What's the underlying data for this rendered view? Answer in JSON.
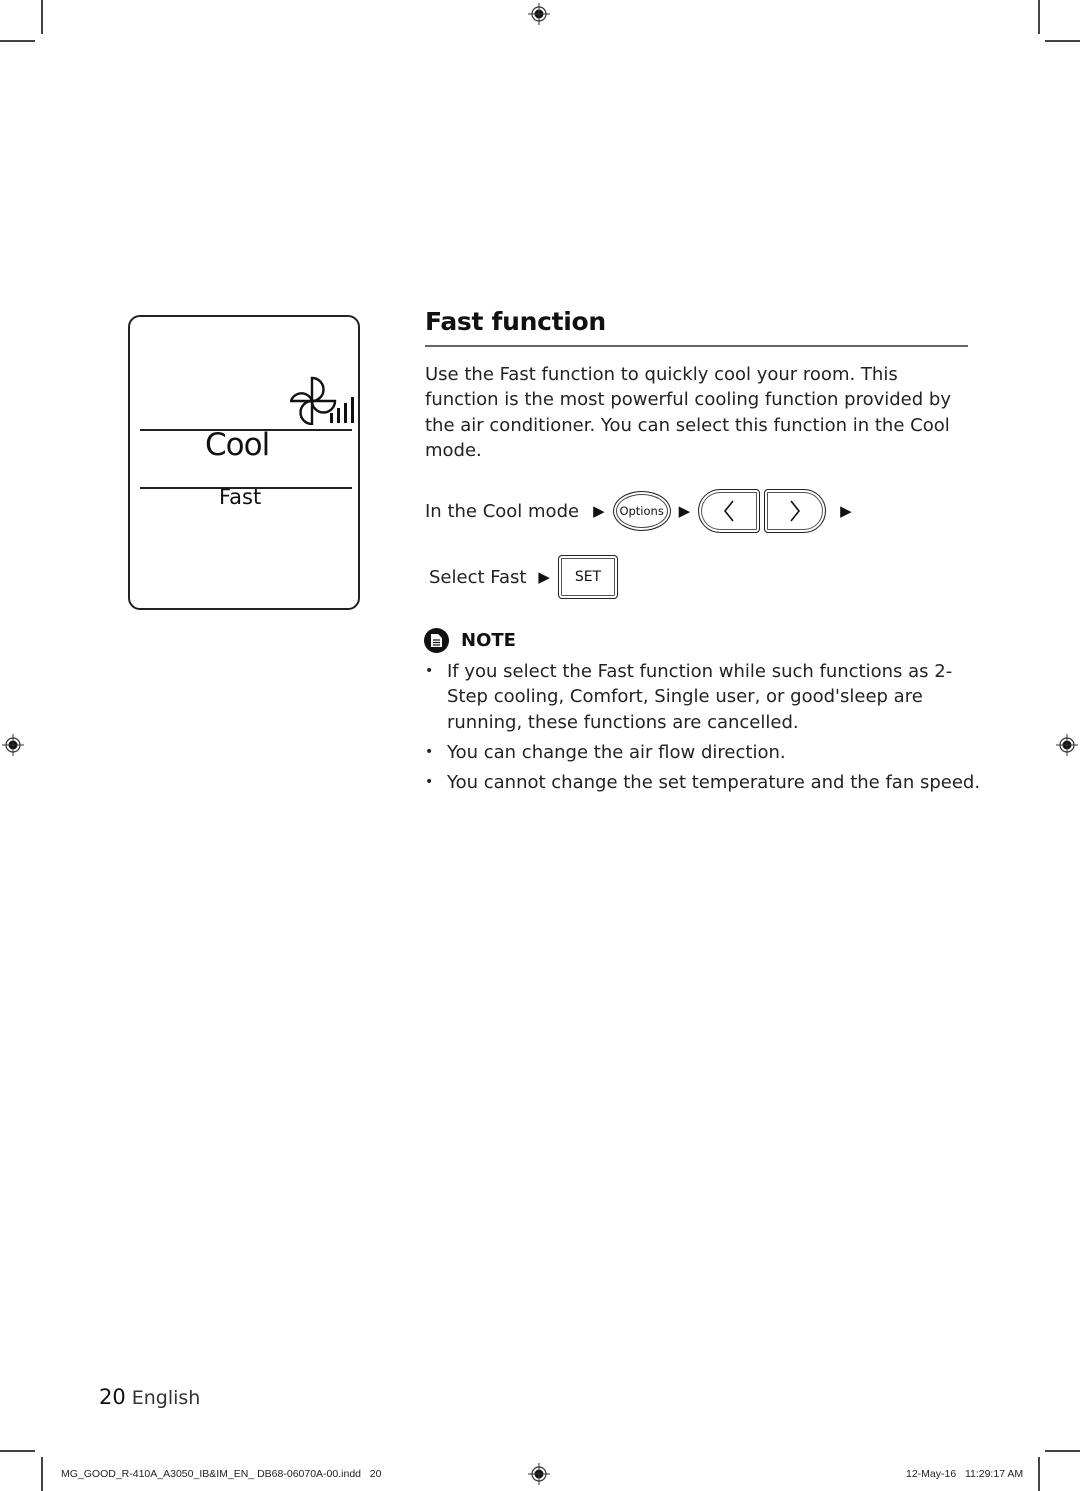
{
  "display_panel": {
    "mode": "Cool",
    "option": "Fast",
    "fan_icon": "fan-speed-icon"
  },
  "section": {
    "title": "Fast function",
    "intro": "Use the Fast function to quickly cool your room. This function is the most powerful cooling function provided by the air conditioner. You can select this function in the Cool mode."
  },
  "steps": {
    "step1_label": "In the Cool mode",
    "options_button": "Options",
    "left_button": "left-arrow",
    "right_button": "right-arrow",
    "step2_label": "Select Fast",
    "set_button": "SET",
    "arrow_glyph": "▶"
  },
  "note": {
    "label": "NOTE",
    "items": [
      "If you select the Fast function while such functions as 2-Step cooling, Comfort, Single user, or good'sleep are running, these functions are cancelled.",
      "You can change the air flow direction.",
      "You cannot change the set temperature and the fan speed."
    ]
  },
  "footer": {
    "page_number": "20",
    "language": "English",
    "slug_file": "MG_GOOD_R-410A_A3050_IB&IM_EN_ DB68-06070A-00.indd   20",
    "slug_date": "12-May-16   11:29:17 AM"
  }
}
